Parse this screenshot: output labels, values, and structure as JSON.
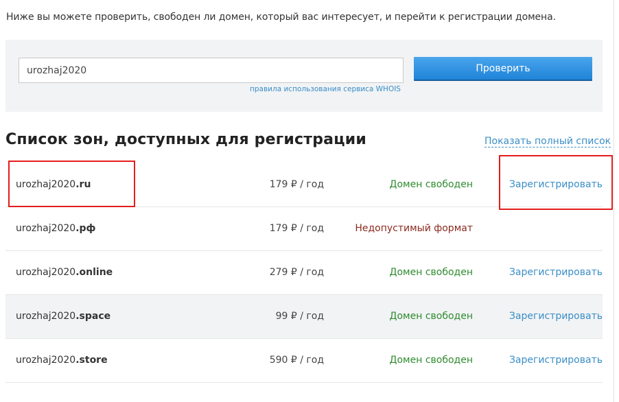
{
  "intro_text": "Ниже вы можете проверить, свободен ли домен, который вас интересует, и перейти к регистрации домена.",
  "search": {
    "value": "urozhaj2020",
    "check_label": "Проверить",
    "whois_link": "правила использования сервиса WHOIS"
  },
  "zones": {
    "title": "Список зон, доступных для регистрации",
    "show_all_label": "Показать полный список",
    "rows": [
      {
        "name": "urozhaj2020",
        "zone": ".ru",
        "price": "179 ₽ / год",
        "status": "Домен свободен",
        "status_type": "free",
        "action": "Зарегистрировать"
      },
      {
        "name": "urozhaj2020",
        "zone": ".рф",
        "price": "179 ₽ / год",
        "status": "Недопустимый формат",
        "status_type": "invalid",
        "action": ""
      },
      {
        "name": "urozhaj2020",
        "zone": ".online",
        "price": "279 ₽ / год",
        "status": "Домен свободен",
        "status_type": "free",
        "action": "Зарегистрировать"
      },
      {
        "name": "urozhaj2020",
        "zone": ".space",
        "price": "99 ₽ / год",
        "status": "Домен свободен",
        "status_type": "free",
        "action": "Зарегистрировать"
      },
      {
        "name": "urozhaj2020",
        "zone": ".store",
        "price": "590 ₽ / год",
        "status": "Домен свободен",
        "status_type": "free",
        "action": "Зарегистрировать"
      }
    ]
  },
  "colors": {
    "accent": "#3a8ec6",
    "button": "#1f84d8",
    "status_free": "#2e8b2e",
    "status_invalid": "#8b2a1e",
    "highlight": "#e51b1b"
  }
}
